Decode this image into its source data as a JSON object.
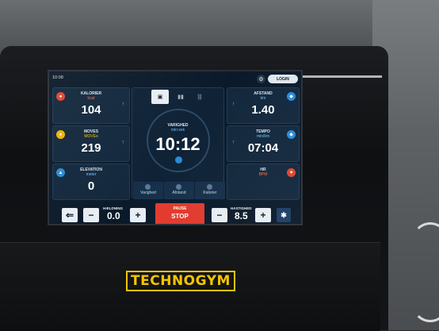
{
  "clock": "10:08",
  "login_label": "LOGIN",
  "metrics_left": [
    {
      "label": "KALORIER",
      "unit": "kcal",
      "value": "104",
      "unit_color": "#ff6a4d",
      "icon": "flame-icon",
      "icon_color": "#e0452f"
    },
    {
      "label": "MOVES",
      "unit": "MOVEs",
      "value": "219",
      "unit_color": "#f5c400",
      "icon": "moves-icon",
      "icon_color": "#f0b400"
    },
    {
      "label": "ELEVATION",
      "unit": "meter",
      "value": "0",
      "unit_color": "#6cc4ff",
      "icon": "mountain-icon",
      "icon_color": "#2a8bd6"
    }
  ],
  "metrics_right": [
    {
      "label": "AFSTAND",
      "unit": "km",
      "value": "1.40",
      "unit_color": "#6cc4ff",
      "icon": "distance-icon",
      "icon_color": "#2a8bd6"
    },
    {
      "label": "TEMPO",
      "unit": "min/km",
      "value": "07:04",
      "unit_color": "#6cc4ff",
      "icon": "speed-icon",
      "icon_color": "#2a8bd6"
    },
    {
      "label": "HR",
      "unit": "BPM",
      "value": "",
      "unit_color": "#ff6a4d",
      "icon": "heart-icon",
      "icon_color": "#e0452f"
    }
  ],
  "center": {
    "label": "VARIGHED",
    "unit": "min:sek",
    "value": "10:12",
    "tabs": [
      "Varighed",
      "Afstand",
      "Kalorier"
    ]
  },
  "controls": {
    "back": "⇐",
    "minus": "−",
    "plus": "+",
    "incline_label": "HÆLDNING",
    "incline_value": "0.0",
    "pause_label": "PAUSE",
    "stop_label": "STOP",
    "speed_label": "HASTIGHED",
    "speed_value": "8.5",
    "bluetooth": "✱"
  },
  "brand": "TECHNOGYM",
  "colors": {
    "accent": "#2a8bd6",
    "stop": "#e23a2e",
    "brand": "#f5c400"
  }
}
